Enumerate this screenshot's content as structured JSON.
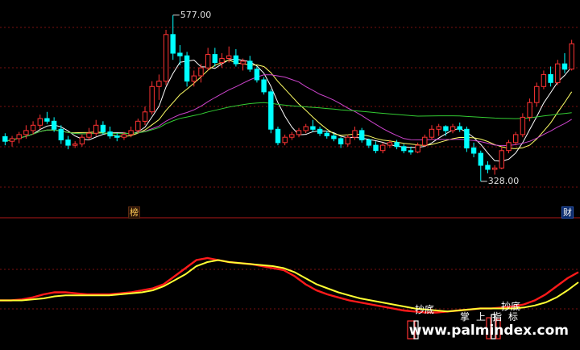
{
  "chart_data": {
    "type": "candlestick",
    "price_range": [
      300,
      590
    ],
    "main_panel": {
      "high_label": "577.00",
      "low_label": "328.00",
      "candles": [
        {
          "o": 395,
          "h": 400,
          "l": 382,
          "c": 388
        },
        {
          "o": 388,
          "h": 396,
          "l": 380,
          "c": 392
        },
        {
          "o": 392,
          "h": 402,
          "l": 385,
          "c": 398
        },
        {
          "o": 398,
          "h": 412,
          "l": 392,
          "c": 404
        },
        {
          "o": 404,
          "h": 418,
          "l": 398,
          "c": 412
        },
        {
          "o": 412,
          "h": 428,
          "l": 406,
          "c": 422
        },
        {
          "o": 422,
          "h": 432,
          "l": 414,
          "c": 418
        },
        {
          "o": 418,
          "h": 424,
          "l": 402,
          "c": 406
        },
        {
          "o": 406,
          "h": 412,
          "l": 384,
          "c": 390
        },
        {
          "o": 390,
          "h": 396,
          "l": 376,
          "c": 382
        },
        {
          "o": 382,
          "h": 388,
          "l": 378,
          "c": 384
        },
        {
          "o": 384,
          "h": 398,
          "l": 380,
          "c": 394
        },
        {
          "o": 394,
          "h": 408,
          "l": 390,
          "c": 400
        },
        {
          "o": 400,
          "h": 420,
          "l": 396,
          "c": 412
        },
        {
          "o": 412,
          "h": 418,
          "l": 398,
          "c": 402
        },
        {
          "o": 402,
          "h": 410,
          "l": 392,
          "c": 396
        },
        {
          "o": 396,
          "h": 400,
          "l": 388,
          "c": 394
        },
        {
          "o": 394,
          "h": 402,
          "l": 390,
          "c": 398
        },
        {
          "o": 398,
          "h": 410,
          "l": 394,
          "c": 404
        },
        {
          "o": 404,
          "h": 422,
          "l": 400,
          "c": 418
        },
        {
          "o": 418,
          "h": 440,
          "l": 412,
          "c": 432
        },
        {
          "o": 432,
          "h": 478,
          "l": 428,
          "c": 470
        },
        {
          "o": 470,
          "h": 488,
          "l": 450,
          "c": 478
        },
        {
          "o": 478,
          "h": 555,
          "l": 472,
          "c": 548
        },
        {
          "o": 548,
          "h": 577,
          "l": 510,
          "c": 520
        },
        {
          "o": 520,
          "h": 532,
          "l": 502,
          "c": 516
        },
        {
          "o": 516,
          "h": 522,
          "l": 470,
          "c": 478
        },
        {
          "o": 478,
          "h": 494,
          "l": 470,
          "c": 486
        },
        {
          "o": 486,
          "h": 504,
          "l": 476,
          "c": 498
        },
        {
          "o": 498,
          "h": 528,
          "l": 494,
          "c": 518
        },
        {
          "o": 518,
          "h": 528,
          "l": 500,
          "c": 506
        },
        {
          "o": 506,
          "h": 520,
          "l": 498,
          "c": 512
        },
        {
          "o": 512,
          "h": 530,
          "l": 506,
          "c": 516
        },
        {
          "o": 516,
          "h": 526,
          "l": 500,
          "c": 504
        },
        {
          "o": 504,
          "h": 512,
          "l": 494,
          "c": 508
        },
        {
          "o": 508,
          "h": 516,
          "l": 492,
          "c": 496
        },
        {
          "o": 496,
          "h": 500,
          "l": 476,
          "c": 480
        },
        {
          "o": 480,
          "h": 484,
          "l": 458,
          "c": 462
        },
        {
          "o": 462,
          "h": 466,
          "l": 400,
          "c": 406
        },
        {
          "o": 406,
          "h": 410,
          "l": 382,
          "c": 386
        },
        {
          "o": 386,
          "h": 398,
          "l": 382,
          "c": 394
        },
        {
          "o": 394,
          "h": 402,
          "l": 390,
          "c": 398
        },
        {
          "o": 398,
          "h": 408,
          "l": 394,
          "c": 404
        },
        {
          "o": 404,
          "h": 414,
          "l": 400,
          "c": 410
        },
        {
          "o": 410,
          "h": 420,
          "l": 402,
          "c": 406
        },
        {
          "o": 406,
          "h": 410,
          "l": 396,
          "c": 400
        },
        {
          "o": 400,
          "h": 404,
          "l": 392,
          "c": 396
        },
        {
          "o": 396,
          "h": 400,
          "l": 388,
          "c": 392
        },
        {
          "o": 392,
          "h": 394,
          "l": 378,
          "c": 384
        },
        {
          "o": 384,
          "h": 398,
          "l": 380,
          "c": 394
        },
        {
          "o": 394,
          "h": 410,
          "l": 390,
          "c": 404
        },
        {
          "o": 404,
          "h": 408,
          "l": 386,
          "c": 390
        },
        {
          "o": 390,
          "h": 392,
          "l": 378,
          "c": 382
        },
        {
          "o": 382,
          "h": 388,
          "l": 370,
          "c": 374
        },
        {
          "o": 374,
          "h": 386,
          "l": 370,
          "c": 382
        },
        {
          "o": 382,
          "h": 390,
          "l": 378,
          "c": 386
        },
        {
          "o": 386,
          "h": 390,
          "l": 376,
          "c": 380
        },
        {
          "o": 380,
          "h": 384,
          "l": 370,
          "c": 374
        },
        {
          "o": 374,
          "h": 380,
          "l": 368,
          "c": 372
        },
        {
          "o": 372,
          "h": 386,
          "l": 370,
          "c": 382
        },
        {
          "o": 382,
          "h": 398,
          "l": 380,
          "c": 394
        },
        {
          "o": 394,
          "h": 412,
          "l": 390,
          "c": 406
        },
        {
          "o": 406,
          "h": 414,
          "l": 396,
          "c": 410
        },
        {
          "o": 410,
          "h": 412,
          "l": 396,
          "c": 404
        },
        {
          "o": 404,
          "h": 414,
          "l": 400,
          "c": 410
        },
        {
          "o": 410,
          "h": 416,
          "l": 402,
          "c": 406
        },
        {
          "o": 406,
          "h": 410,
          "l": 372,
          "c": 378
        },
        {
          "o": 378,
          "h": 386,
          "l": 364,
          "c": 370
        },
        {
          "o": 370,
          "h": 374,
          "l": 328,
          "c": 352
        },
        {
          "o": 352,
          "h": 358,
          "l": 340,
          "c": 346
        },
        {
          "o": 346,
          "h": 352,
          "l": 338,
          "c": 348
        },
        {
          "o": 348,
          "h": 380,
          "l": 346,
          "c": 374
        },
        {
          "o": 374,
          "h": 390,
          "l": 370,
          "c": 386
        },
        {
          "o": 386,
          "h": 402,
          "l": 382,
          "c": 398
        },
        {
          "o": 398,
          "h": 430,
          "l": 394,
          "c": 424
        },
        {
          "o": 424,
          "h": 452,
          "l": 418,
          "c": 446
        },
        {
          "o": 446,
          "h": 476,
          "l": 440,
          "c": 470
        },
        {
          "o": 470,
          "h": 494,
          "l": 466,
          "c": 488
        },
        {
          "o": 488,
          "h": 500,
          "l": 470,
          "c": 476
        },
        {
          "o": 476,
          "h": 510,
          "l": 472,
          "c": 504
        },
        {
          "o": 504,
          "h": 520,
          "l": 490,
          "c": 496
        },
        {
          "o": 496,
          "h": 540,
          "l": 494,
          "c": 534
        }
      ],
      "mas": [
        {
          "name": "MA5",
          "color": "#ffffff",
          "period": 5
        },
        {
          "name": "MA10",
          "color": "#ffff66",
          "period": 10
        },
        {
          "name": "MA20",
          "color": "#cc44cc",
          "period": 20
        },
        {
          "name": "MA60",
          "color": "#33cc33",
          "period": 60
        }
      ]
    },
    "indicator_panel": {
      "range": [
        0,
        100
      ],
      "red_line": [
        30,
        30,
        31,
        33,
        36,
        38,
        38,
        37,
        36,
        36,
        36,
        37,
        38,
        40,
        42,
        46,
        54,
        62,
        70,
        72,
        70,
        68,
        67,
        66,
        64,
        62,
        60,
        54,
        46,
        40,
        36,
        33,
        30,
        28,
        26,
        24,
        22,
        20,
        19,
        18,
        18,
        19,
        20,
        21,
        22,
        22,
        23,
        24,
        26,
        30,
        36,
        44,
        52,
        58
      ],
      "yellow_line": [
        30,
        30,
        30,
        31,
        32,
        34,
        35,
        35,
        35,
        35,
        35,
        36,
        37,
        38,
        40,
        44,
        50,
        56,
        64,
        68,
        70,
        68,
        67,
        66,
        65,
        64,
        62,
        58,
        52,
        46,
        42,
        38,
        35,
        32,
        30,
        28,
        26,
        24,
        22,
        21,
        20,
        19,
        20,
        21,
        22,
        22,
        22,
        22,
        23,
        25,
        28,
        33,
        40,
        48
      ]
    },
    "signals": [
      {
        "text": "抄底"
      },
      {
        "text": "掌上指标"
      },
      {
        "text": "抄底"
      }
    ]
  },
  "tags": {
    "rank": "榜",
    "finance": "财"
  },
  "watermark": "www.palmindex.com",
  "colors": {
    "up": "#ff3333",
    "down": "#00ffff",
    "grid": "#7a1010",
    "axis": "#b01818"
  }
}
